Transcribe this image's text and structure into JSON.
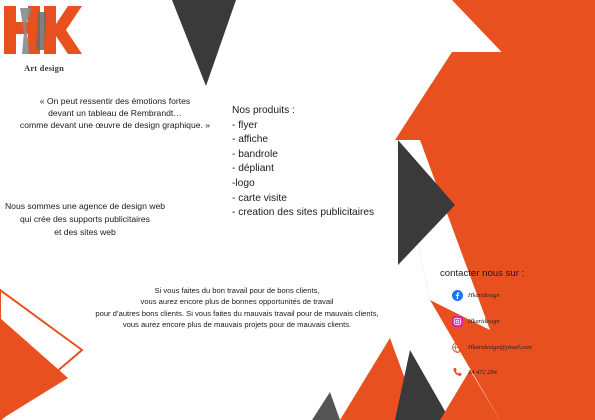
{
  "brand": {
    "logo_text": "HK",
    "tagline": "Art design"
  },
  "quote": {
    "lines": [
      "« On peut ressentir des émotions fortes",
      "devant un tableau de Rembrandt…",
      "comme devant une œuvre de design graphique. »"
    ]
  },
  "agency": {
    "lines": [
      "Nous sommes une agence de design web",
      "qui crée des supports publicitaires",
      "et des sites web"
    ]
  },
  "products": {
    "title": "Nos produits :",
    "items": [
      "- flyer",
      "- affiche",
      "- bandrole",
      "- dépliant",
      "-logo",
      "- carte visite",
      "- creation des sites publicitaires"
    ]
  },
  "advice": {
    "lines": [
      "Si vous faites du bon travail pour de bons clients,",
      "vous aurez encore plus de bonnes opportunités de travail",
      "pour d’autres bons clients. Si vous faites du mauvais travail pour de mauvais clients,",
      "vous aurez encore plus de mauvais projets pour de mauvais clients."
    ]
  },
  "contact": {
    "title": "contacter nous sur :",
    "items": [
      {
        "icon": "facebook-icon",
        "text": "Hkartdesign"
      },
      {
        "icon": "instagram-icon",
        "text": "Hkartdesign"
      },
      {
        "icon": "web-icon",
        "text": "Hkartdesign@ymail.com"
      },
      {
        "icon": "phone-icon",
        "text": "24 472 284"
      }
    ]
  },
  "colors": {
    "accent": "#e8501f",
    "dark": "#3a3a3a",
    "grey": "#555555"
  }
}
